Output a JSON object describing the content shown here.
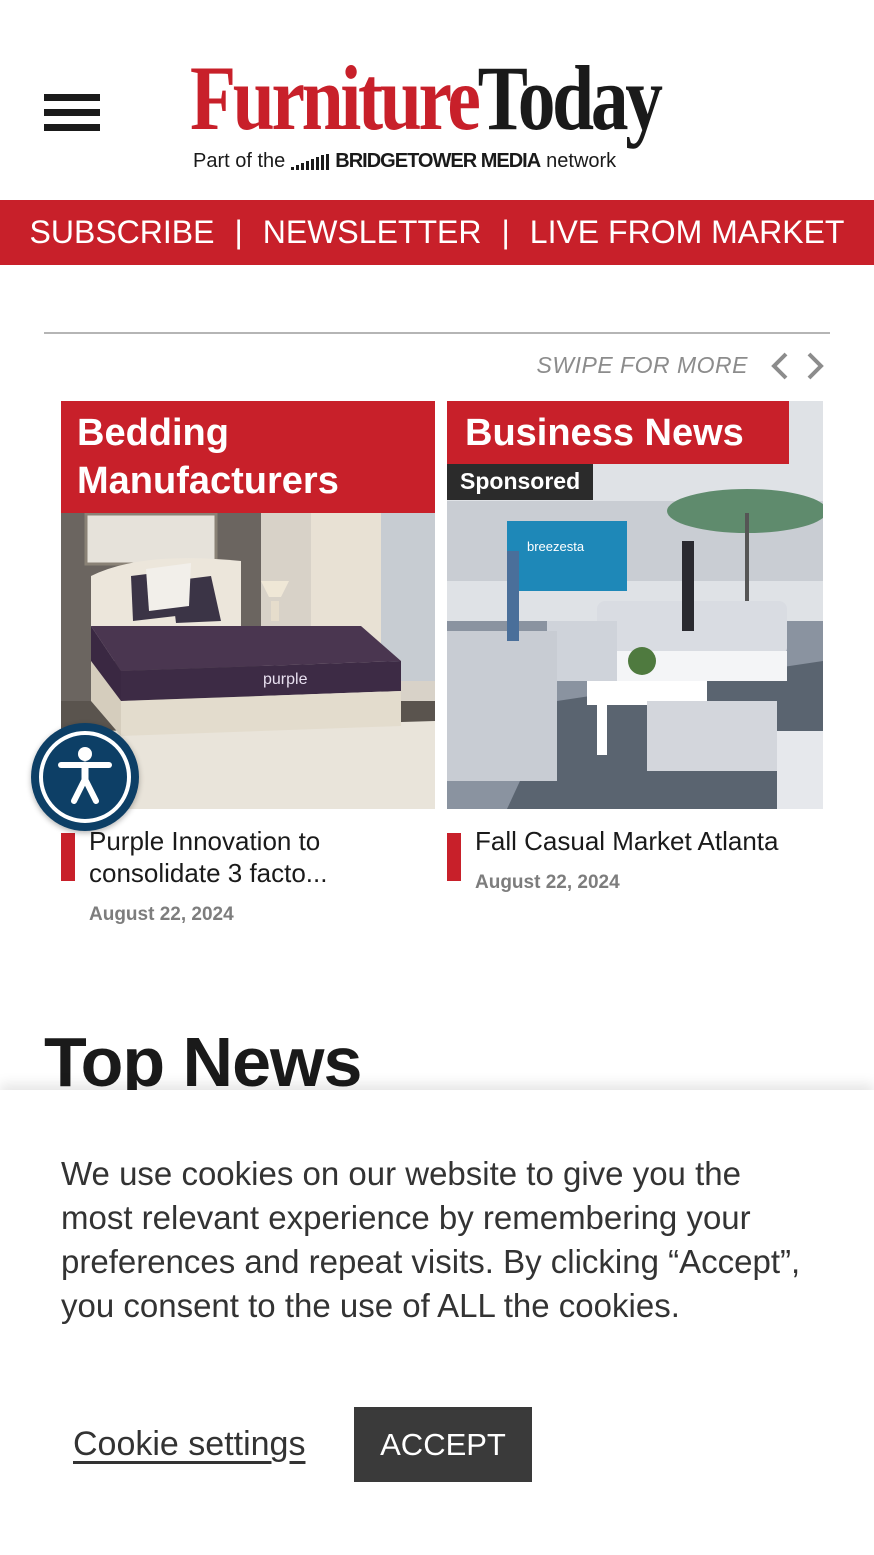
{
  "header": {
    "logo_word_1": "Furniture",
    "logo_word_2": "Today",
    "logo_sub_prefix": "Part of the",
    "logo_sub_brand": "BRIDGETOWER MEDIA",
    "logo_sub_suffix": "network"
  },
  "nav": {
    "items": [
      {
        "label": "SUBSCRIBE"
      },
      {
        "label": "NEWSLETTER"
      },
      {
        "label": "LIVE FROM MARKET"
      }
    ],
    "separator": "|"
  },
  "carousel": {
    "swipe_label": "SWIPE FOR MORE",
    "cards": [
      {
        "category": "Bedding Manufacturers",
        "sponsored": "",
        "title": "Purple Innovation to consolidate 3 facto...",
        "date": "August 22, 2024",
        "image": "purple mattress bedroom photo"
      },
      {
        "category": "Business News",
        "sponsored": "Sponsored",
        "title": "Fall Casual Market Atlanta",
        "date": "August 22, 2024",
        "image": "outdoor furniture showroom photo"
      }
    ]
  },
  "section": {
    "top_news": "Top News"
  },
  "cookie": {
    "text": "We use cookies on our website to give you the most relevant experience by remembering your preferences and repeat visits. By clicking “Accept”, you consent to the use of ALL the cookies.",
    "settings_label": "Cookie settings",
    "accept_label": "ACCEPT"
  },
  "colors": {
    "brand_red": "#c8202a",
    "dark": "#1a1a1a",
    "accessibility_blue": "#0d3f66"
  },
  "icons": {
    "menu": "hamburger-icon",
    "prev": "chevron-left-icon",
    "next": "chevron-right-icon",
    "accessibility": "accessibility-icon"
  }
}
